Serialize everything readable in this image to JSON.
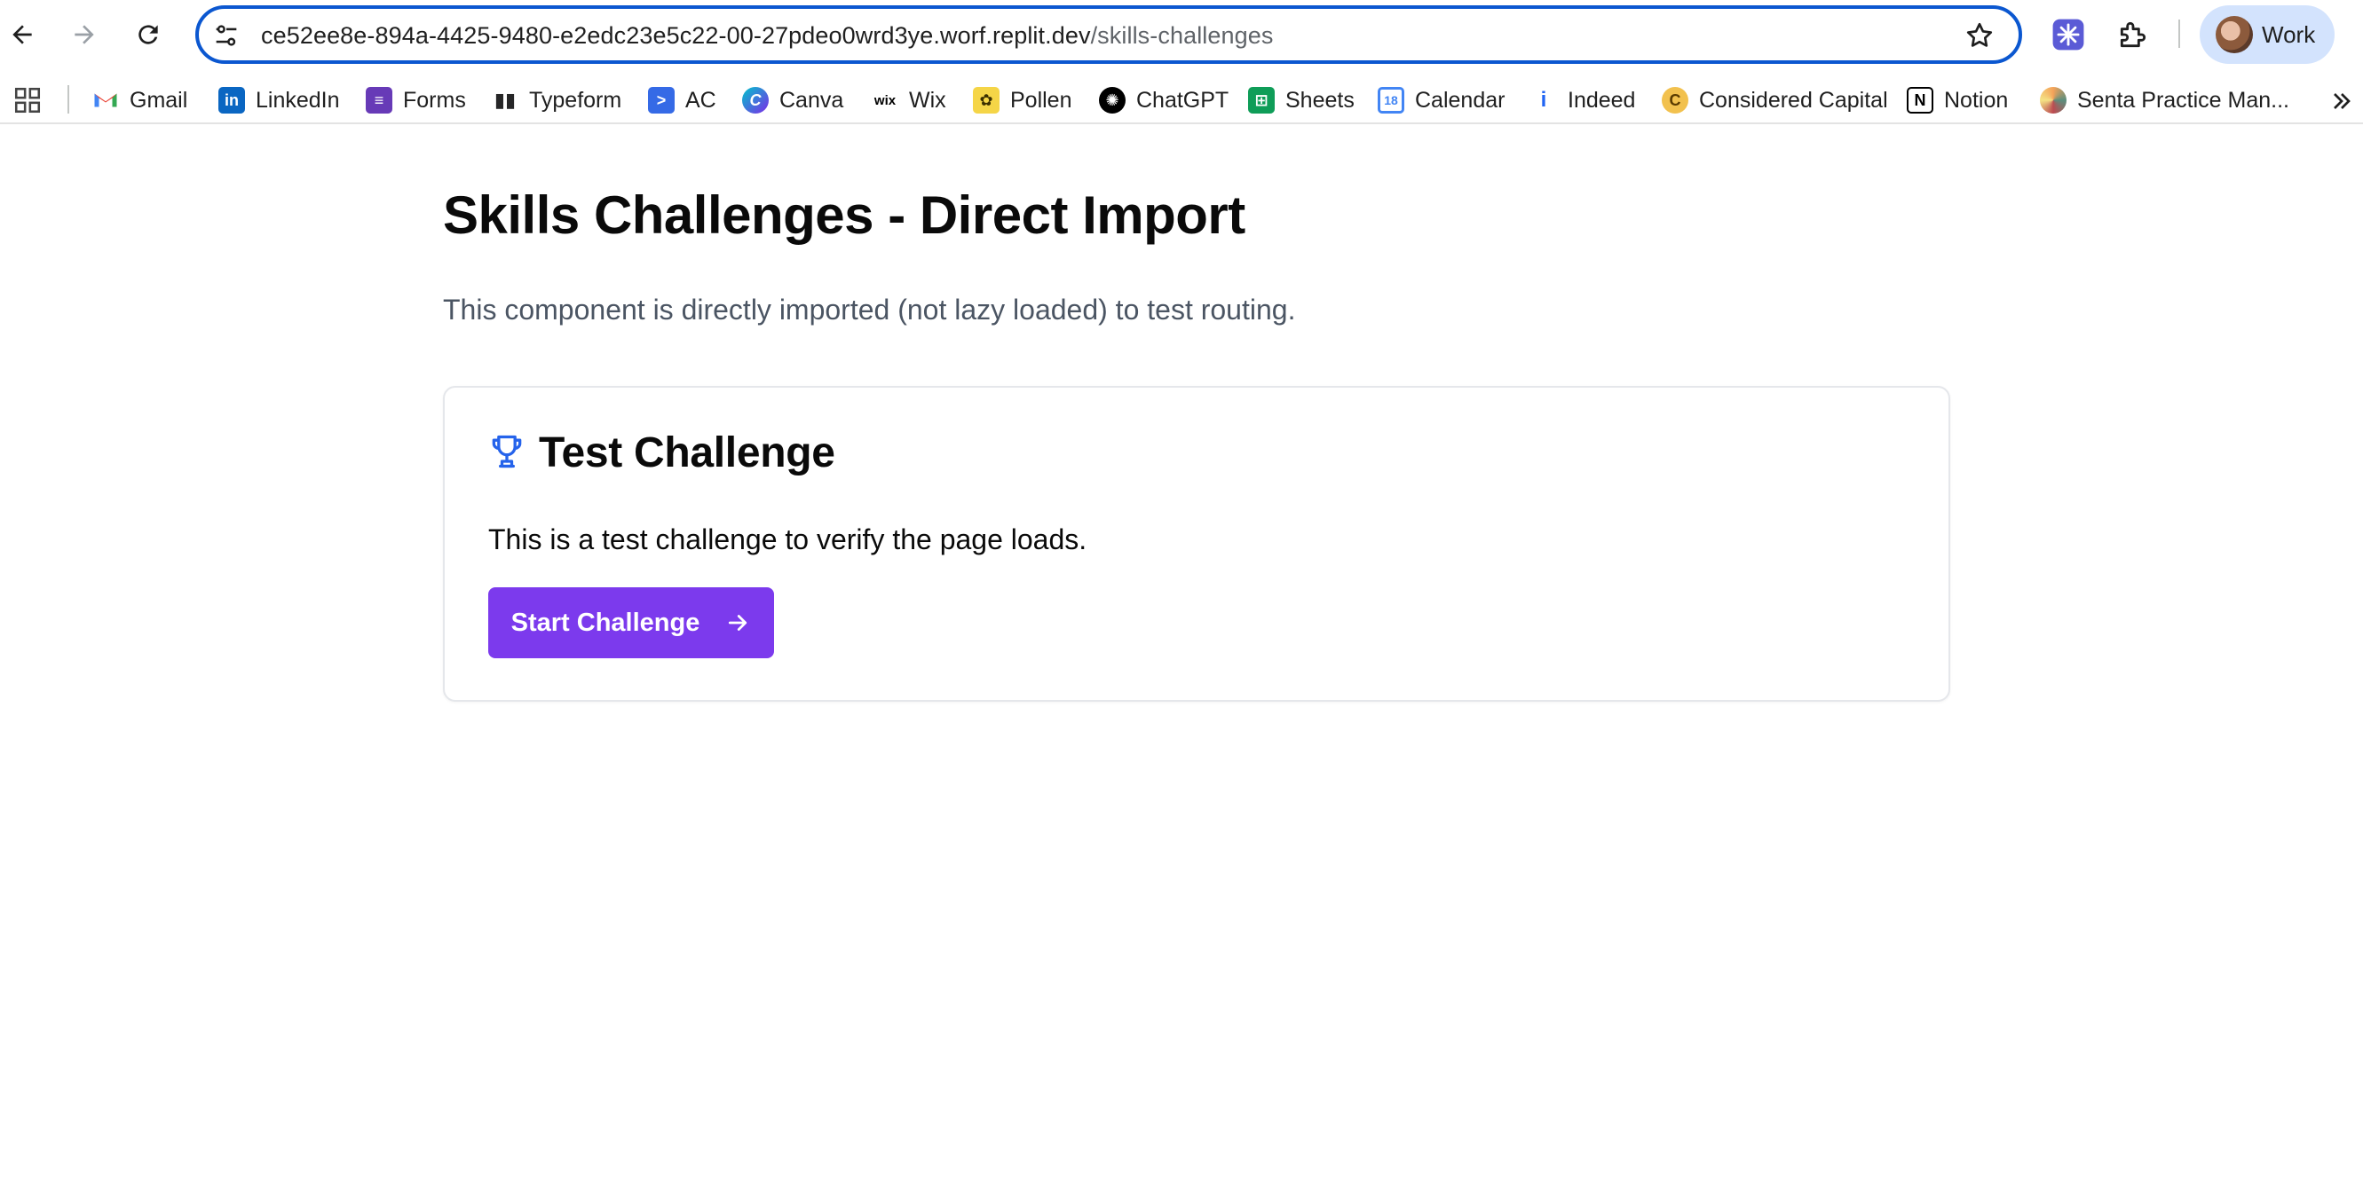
{
  "browser": {
    "url_host": "ce52ee8e-894a-4425-9480-e2edc23e5c22-00-27pdeo0wrd3ye.worf.replit.dev",
    "url_path": "/skills-challenges",
    "profile_label": "Work"
  },
  "bookmarks": [
    {
      "label": "Gmail",
      "icon": "gmail-icon",
      "color": "#ea4335"
    },
    {
      "label": "LinkedIn",
      "icon": "linkedin-icon",
      "color": "#0a66c2"
    },
    {
      "label": "Forms",
      "icon": "forms-icon",
      "color": "#673ab7"
    },
    {
      "label": "Typeform",
      "icon": "typeform-icon",
      "color": "#262627"
    },
    {
      "label": "AC",
      "icon": "ac-icon",
      "color": "#356ae6"
    },
    {
      "label": "Canva",
      "icon": "canva-icon",
      "color": "#7d2ae8"
    },
    {
      "label": "Wix",
      "icon": "wix-icon",
      "color": "#000000"
    },
    {
      "label": "Pollen",
      "icon": "pollen-icon",
      "color": "#f5d547"
    },
    {
      "label": "ChatGPT",
      "icon": "chatgpt-icon",
      "color": "#000000"
    },
    {
      "label": "Sheets",
      "icon": "sheets-icon",
      "color": "#0f9d58"
    },
    {
      "label": "Calendar",
      "icon": "calendar-icon",
      "color": "#4285f4"
    },
    {
      "label": "Indeed",
      "icon": "indeed-icon",
      "color": "#2164f3"
    },
    {
      "label": "Considered Capital",
      "icon": "considered-capital-icon",
      "color": "#d4a017"
    },
    {
      "label": "Notion",
      "icon": "notion-icon",
      "color": "#000000"
    },
    {
      "label": "Senta Practice Man...",
      "icon": "senta-icon",
      "color": "#f4a259"
    }
  ],
  "page": {
    "title": "Skills Challenges - Direct Import",
    "description": "This component is directly imported (not lazy loaded) to test routing."
  },
  "card": {
    "title": "Test Challenge",
    "description": "This is a test challenge to verify the page loads.",
    "button_label": "Start Challenge"
  },
  "colors": {
    "accent": "#7c3aed",
    "trophy": "#2563eb",
    "omnibox_border": "#0b57d0"
  }
}
